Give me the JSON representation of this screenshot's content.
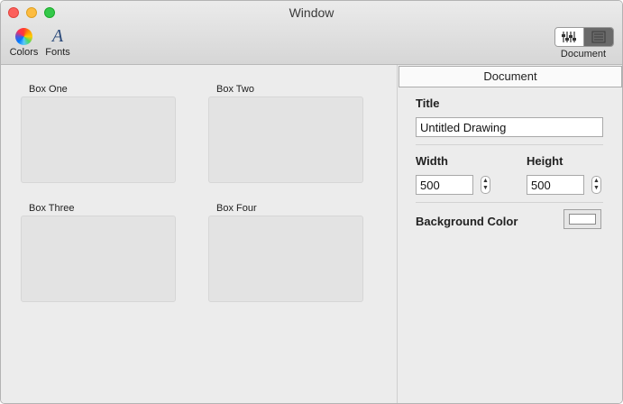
{
  "window": {
    "title": "Window"
  },
  "toolbar": {
    "colors_label": "Colors",
    "fonts_label": "Fonts",
    "fonts_glyph": "A",
    "document_label": "Document"
  },
  "boxes": [
    {
      "title": "Box One"
    },
    {
      "title": "Box Two"
    },
    {
      "title": "Box Three"
    },
    {
      "title": "Box Four"
    }
  ],
  "inspector": {
    "tab": "Document",
    "title_label": "Title",
    "title_value": "Untitled Drawing",
    "width_label": "Width",
    "width_value": "500",
    "height_label": "Height",
    "height_value": "500",
    "background_label": "Background Color",
    "background_color": "#ffffff"
  },
  "colors": {
    "close": "#fc605c",
    "minimize": "#fdbc40",
    "maximize": "#34c84a"
  }
}
